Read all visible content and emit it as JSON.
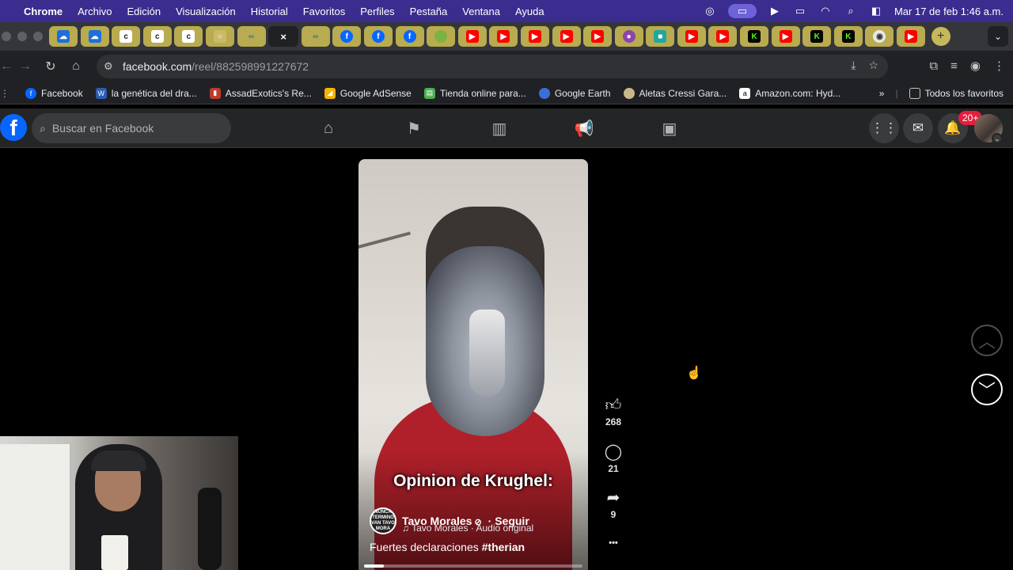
{
  "menubar": {
    "app": "Chrome",
    "items": [
      "Archivo",
      "Edición",
      "Visualización",
      "Historial",
      "Favoritos",
      "Perfiles",
      "Pestaña",
      "Ventana",
      "Ayuda"
    ],
    "clock": "Mar 17 de feb  1:46 a.m."
  },
  "tabs": {
    "active_close": "×",
    "new_tab": "+"
  },
  "toolbar": {
    "url_host": "facebook.com",
    "url_path": "/reel/882598991227672"
  },
  "bookmarks": [
    {
      "label": "Facebook",
      "icon": "facebook-icon",
      "color": "#0866ff",
      "glyph": "f"
    },
    {
      "label": "la genética del dra...",
      "icon": "wordpress-icon",
      "color": "#2a5db0",
      "glyph": "W"
    },
    {
      "label": "AssadExotics's Re...",
      "icon": "analytics-icon",
      "color": "#c0392b",
      "glyph": "▮"
    },
    {
      "label": "Google AdSense",
      "icon": "adsense-icon",
      "color": "#f4b400",
      "glyph": "◢"
    },
    {
      "label": "Tienda online para...",
      "icon": "store-icon",
      "color": "#4caf50",
      "glyph": "▤"
    },
    {
      "label": "Google Earth",
      "icon": "earth-icon",
      "color": "#3b6fd8",
      "glyph": "●"
    },
    {
      "label": "Aletas Cressi Gara...",
      "icon": "fins-icon",
      "color": "#c8b98c",
      "glyph": "◆"
    },
    {
      "label": "Amazon.com: Hyd...",
      "icon": "amazon-icon",
      "color": "#ffffff",
      "glyph": "a"
    }
  ],
  "bookmarks_more": "»",
  "all_favorites": "Todos los favoritos",
  "fb": {
    "logo": "f",
    "search_placeholder": "Buscar en Facebook",
    "notifications_badge": "20+"
  },
  "reel": {
    "overlay_title": "Opinion de Krughel:",
    "author_avatar_text": "NUNCA TERMINO VAN TAVO MORA",
    "author": "Tavo Morales",
    "verified": "⊘",
    "follow": "· Seguir",
    "audio": "♫ Tavo Morales · Audio original",
    "caption_text": "Fuertes declaraciones ",
    "caption_tag": "#therian",
    "progress": 0.09
  },
  "actions": {
    "likes": "268",
    "comments": "21",
    "shares": "9",
    "more": "•••"
  }
}
